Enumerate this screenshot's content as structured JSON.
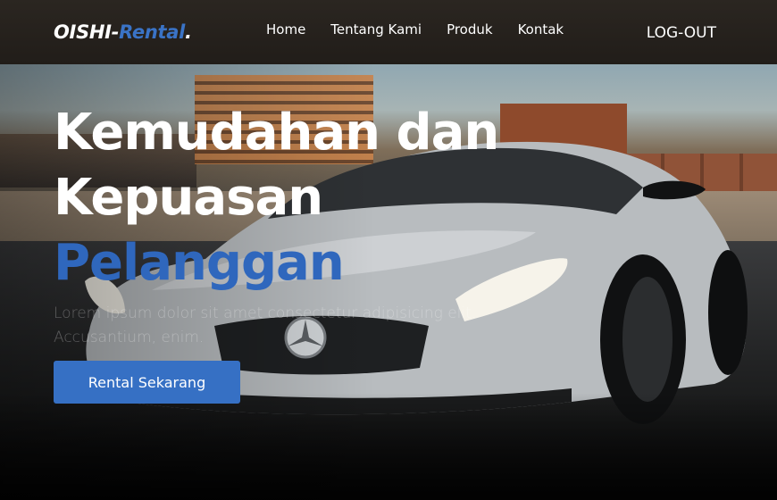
{
  "navbar": {
    "brand_main": "OISHI-",
    "brand_accent": "Rental",
    "brand_dot": ".",
    "links": [
      "Home",
      "Tentang Kami",
      "Produk",
      "Kontak"
    ],
    "logout_label": "LOG-OUT"
  },
  "hero": {
    "title_line1": "Kemudahan dan",
    "title_line2": "Kepuasan",
    "title_accent": "Pelanggan",
    "description": "Lorem ipsum dolor sit amet consectetur adipisicing elit. Accusantium, enim.",
    "cta_label": "Rental Sekarang"
  },
  "colors": {
    "accent": "#3670c4",
    "navbar_bg": "#2a2520",
    "text": "#ffffff"
  }
}
